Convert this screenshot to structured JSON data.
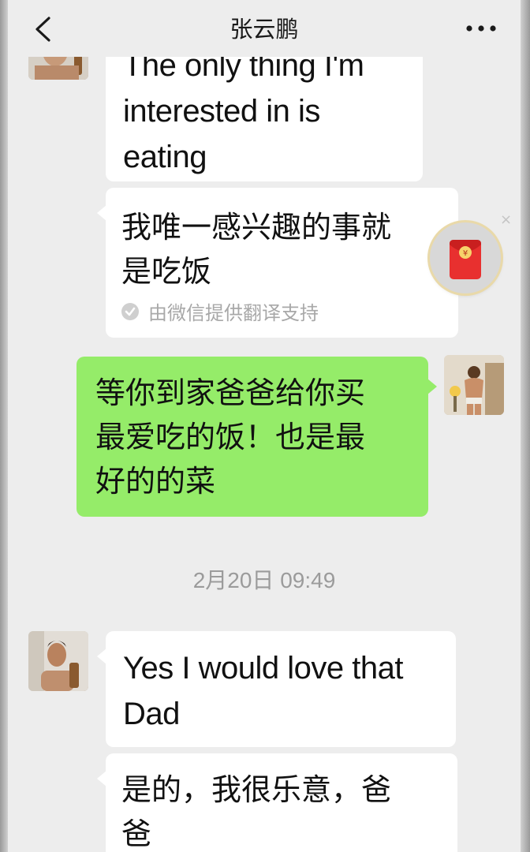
{
  "nav": {
    "title": "张云鹏",
    "back_icon": "chevron-left-icon",
    "more_icon": "more-horizontal-icon"
  },
  "messages": [
    {
      "side": "in",
      "lines": [
        "The only thing I'm",
        "interested in is",
        "eating"
      ]
    },
    {
      "side": "in",
      "lines": [
        "我唯一感兴趣的事就",
        "是吃饭"
      ],
      "translation_note": "由微信提供翻译支持"
    },
    {
      "side": "out",
      "lines": [
        "等你到家爸爸给你买",
        "最爱吃的饭！也是最",
        "好的的菜"
      ]
    },
    {
      "side": "in",
      "lines": [
        "Yes I would love that",
        "Dad"
      ]
    },
    {
      "side": "in",
      "lines": [
        "是的，我很乐意，爸",
        "爸"
      ]
    }
  ],
  "timestamp": "2月20日 09:49",
  "red_packet": {
    "icon": "red-envelope-icon",
    "symbol": "¥",
    "close_symbol": "×"
  },
  "colors": {
    "screen_bg": "#ededed",
    "incoming_bubble": "#ffffff",
    "outgoing_bubble": "#95ec69",
    "timestamp_text": "#9b9b9b",
    "red_packet": "#e8302f"
  }
}
